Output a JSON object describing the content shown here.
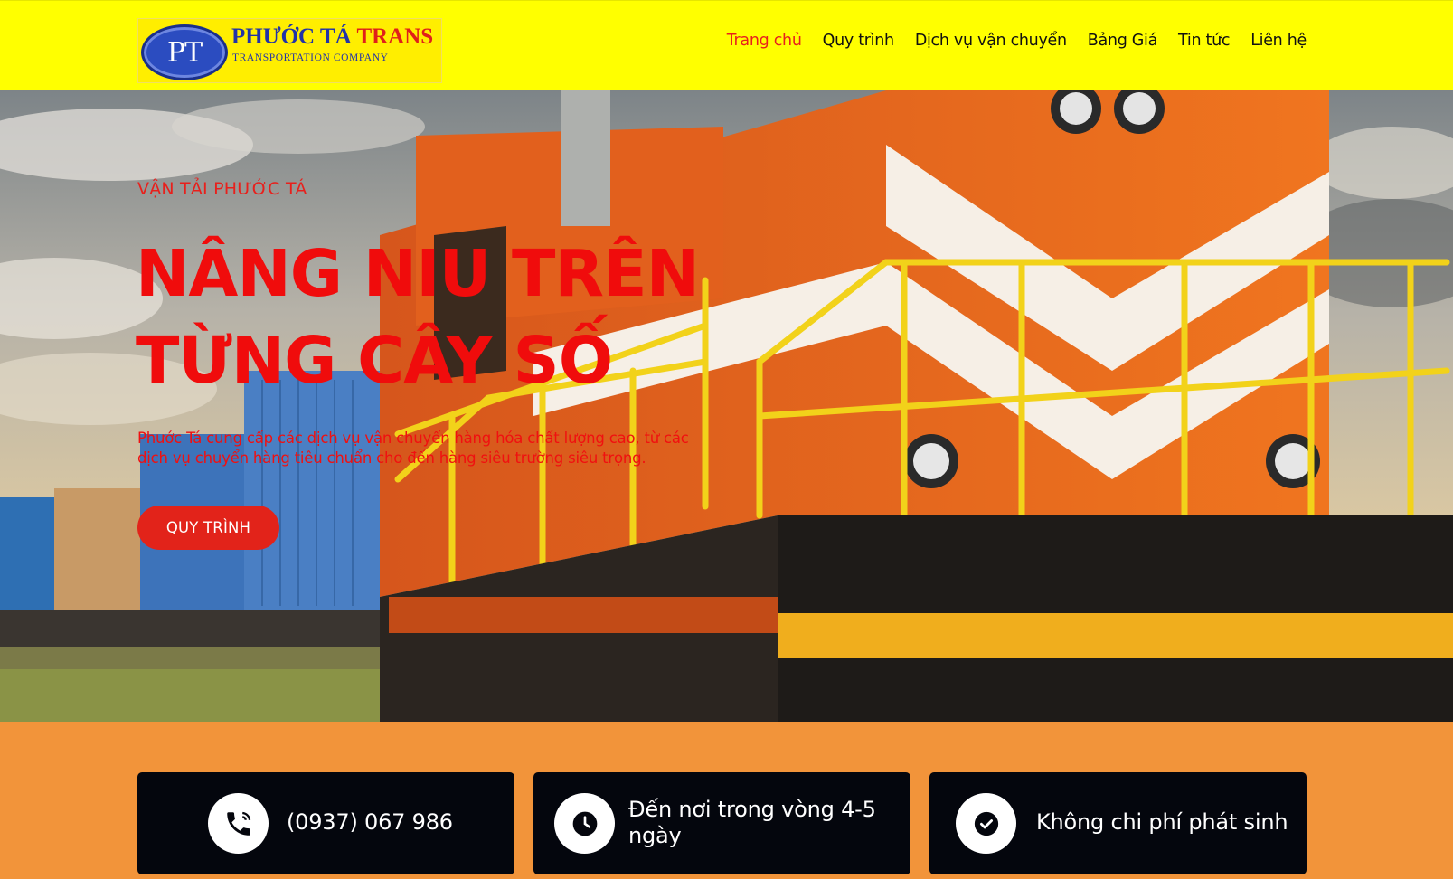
{
  "logo": {
    "monogram": "PT",
    "name_main": "PHƯỚC TÁ ",
    "name_accent": "TRANS",
    "tagline": "TRANSPORTATION COMPANY"
  },
  "nav": {
    "items": [
      "Trang chủ",
      "Quy trình",
      "Dịch vụ vận chuyển",
      "Bảng Giá",
      "Tin tức",
      "Liên hệ"
    ],
    "active_index": 0
  },
  "hero": {
    "eyebrow": "VẬN TẢI PHƯỚC TÁ",
    "title_line1": "NÂNG NIU TRÊN",
    "title_line2": "TỪNG CÂY SỐ",
    "description": "Phước Tá cung cấp các dịch vụ vận chuyển hàng hóa chất lượng cao, từ các dịch vụ chuyển hàng tiêu chuẩn cho đến hàng siêu trường siêu trọng.",
    "button_label": "QUY TRÌNH"
  },
  "features": [
    {
      "icon": "phone-icon",
      "text": "(0937) 067 986"
    },
    {
      "icon": "clock-icon",
      "text": "Đến nơi trong vòng 4-5 ngày"
    },
    {
      "icon": "check-circle-icon",
      "text": "Không chi phí phát sinh"
    }
  ],
  "colors": {
    "header_bg": "#ffff00",
    "accent_red": "#e8201c",
    "features_bg": "#f2943a",
    "card_bg": "#04060d"
  }
}
